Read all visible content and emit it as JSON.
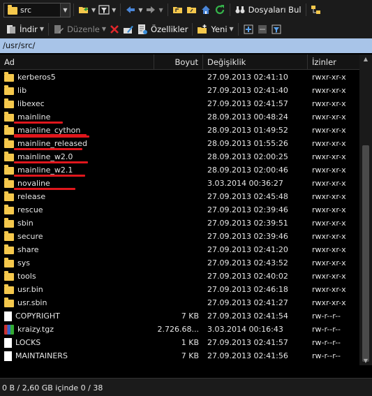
{
  "toolbar1": {
    "location_value": "src",
    "find_files_label": "Dosyaları Bul"
  },
  "toolbar2": {
    "download_label": "İndir",
    "edit_label": "Düzenle",
    "properties_label": "Özellikler",
    "new_label": "Yeni"
  },
  "path": "/usr/src/",
  "columns": {
    "name": "Ad",
    "size": "Boyut",
    "modified": "Değişiklik",
    "permissions": "İzinler"
  },
  "rows": [
    {
      "type": "folder",
      "name": "kerberos5",
      "size": "",
      "modified": "27.09.2013 02:41:10",
      "perm": "rwxr-xr-x"
    },
    {
      "type": "folder",
      "name": "lib",
      "size": "",
      "modified": "27.09.2013 02:41:40",
      "perm": "rwxr-xr-x"
    },
    {
      "type": "folder",
      "name": "libexec",
      "size": "",
      "modified": "27.09.2013 02:41:57",
      "perm": "rwxr-xr-x"
    },
    {
      "type": "folder",
      "name": "mainline",
      "size": "",
      "modified": "28.09.2013 00:48:24",
      "perm": "rwxr-xr-x"
    },
    {
      "type": "folder",
      "name": "mainline_cython",
      "size": "",
      "modified": "28.09.2013 01:49:52",
      "perm": "rwxr-xr-x"
    },
    {
      "type": "folder",
      "name": "mainline_released",
      "size": "",
      "modified": "28.09.2013 01:55:26",
      "perm": "rwxr-xr-x"
    },
    {
      "type": "folder",
      "name": "mainline_w2.0",
      "size": "",
      "modified": "28.09.2013 02:00:25",
      "perm": "rwxr-xr-x"
    },
    {
      "type": "folder",
      "name": "mainline_w2.1",
      "size": "",
      "modified": "28.09.2013 02:00:46",
      "perm": "rwxr-xr-x"
    },
    {
      "type": "folder",
      "name": "novaline",
      "size": "",
      "modified": "3.03.2014 00:36:27",
      "perm": "rwxr-xr-x"
    },
    {
      "type": "folder",
      "name": "release",
      "size": "",
      "modified": "27.09.2013 02:45:48",
      "perm": "rwxr-xr-x"
    },
    {
      "type": "folder",
      "name": "rescue",
      "size": "",
      "modified": "27.09.2013 02:39:46",
      "perm": "rwxr-xr-x"
    },
    {
      "type": "folder",
      "name": "sbin",
      "size": "",
      "modified": "27.09.2013 02:39:51",
      "perm": "rwxr-xr-x"
    },
    {
      "type": "folder",
      "name": "secure",
      "size": "",
      "modified": "27.09.2013 02:39:46",
      "perm": "rwxr-xr-x"
    },
    {
      "type": "folder",
      "name": "share",
      "size": "",
      "modified": "27.09.2013 02:41:20",
      "perm": "rwxr-xr-x"
    },
    {
      "type": "folder",
      "name": "sys",
      "size": "",
      "modified": "27.09.2013 02:43:52",
      "perm": "rwxr-xr-x"
    },
    {
      "type": "folder",
      "name": "tools",
      "size": "",
      "modified": "27.09.2013 02:40:02",
      "perm": "rwxr-xr-x"
    },
    {
      "type": "folder",
      "name": "usr.bin",
      "size": "",
      "modified": "27.09.2013 02:46:18",
      "perm": "rwxr-xr-x"
    },
    {
      "type": "folder",
      "name": "usr.sbin",
      "size": "",
      "modified": "27.09.2013 02:41:27",
      "perm": "rwxr-xr-x"
    },
    {
      "type": "file",
      "name": "COPYRIGHT",
      "size": "7 KB",
      "modified": "27.09.2013 02:41:54",
      "perm": "rw-r--r--"
    },
    {
      "type": "archive",
      "name": "kraizy.tgz",
      "size": "2.726.68...",
      "modified": "3.03.2014 00:16:43",
      "perm": "rw-r--r--"
    },
    {
      "type": "file",
      "name": "LOCKS",
      "size": "1 KB",
      "modified": "27.09.2013 02:41:57",
      "perm": "rw-r--r--"
    },
    {
      "type": "file",
      "name": "MAINTAINERS",
      "size": "7 KB",
      "modified": "27.09.2013 02:41:56",
      "perm": "rw-r--r--"
    }
  ],
  "status": "0 B / 2,60 GB içinde 0 / 38",
  "icons": {
    "location": "folder-icon",
    "open": "folder-open-icon",
    "filter": "filter-icon",
    "back": "arrow-left-icon",
    "forward": "arrow-right-icon",
    "parent": "parent-folder-icon",
    "root": "root-folder-icon",
    "home": "home-icon",
    "refresh": "refresh-icon",
    "find": "binoculars-icon",
    "tree": "tree-icon",
    "download": "download-icon",
    "edit": "edit-icon",
    "delete": "delete-icon",
    "rename": "rename-icon",
    "properties": "properties-icon",
    "new": "new-folder-icon",
    "select_all": "plus-icon",
    "unselect": "minus-icon",
    "filter2": "filter-icon"
  },
  "colors": {
    "path_bar": "#a8c4e8",
    "folder": "#f5c84c",
    "highlight_line": "#e0161c"
  }
}
